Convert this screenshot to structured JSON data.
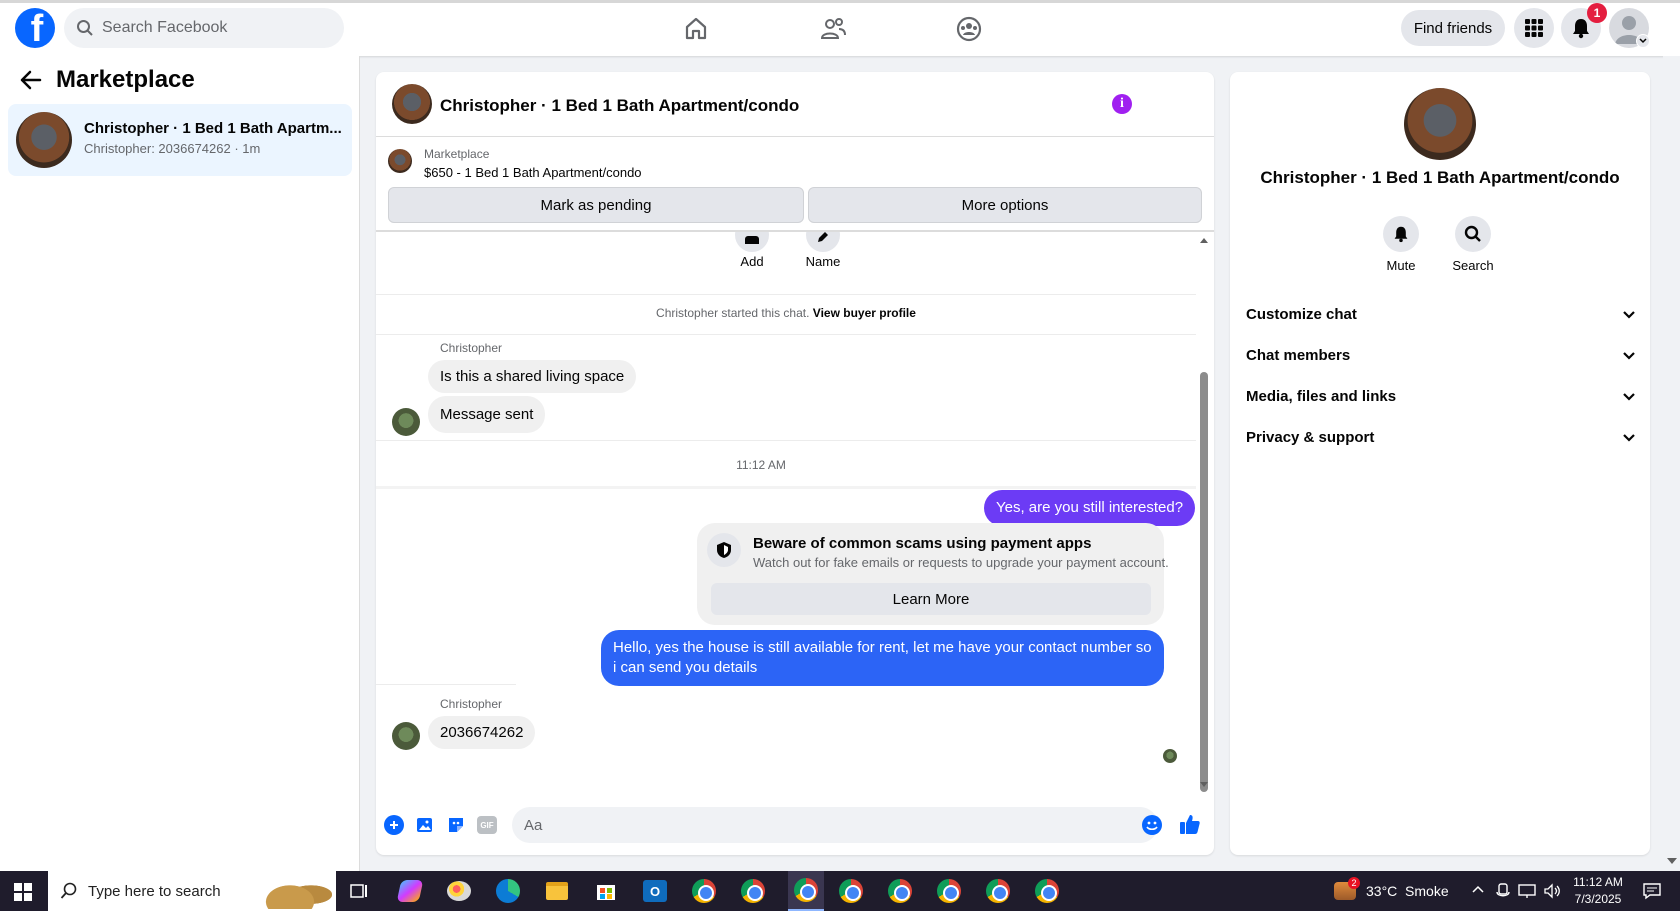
{
  "topbar": {
    "search_placeholder": "Search Facebook",
    "find_friends": "Find friends",
    "notification_count": "1"
  },
  "left": {
    "title": "Marketplace",
    "conversation": {
      "title": "Christopher · 1 Bed 1 Bath Apartm...",
      "subtitle": "Christopher: 2036674262 · 1m"
    }
  },
  "chat": {
    "header_title": "Christopher · 1 Bed 1 Bath Apartment/condo",
    "listing_label": "Marketplace",
    "listing_title": "$650 - 1 Bed 1 Bath Apartment/condo",
    "mark_pending": "Mark as pending",
    "more_options": "More options",
    "add_label": "Add",
    "name_label": "Name",
    "started_text": "Christopher started this chat.",
    "view_buyer": "View buyer profile",
    "sender_name_1": "Christopher",
    "msg_1": "Is this a shared living space",
    "msg_2": "Message sent",
    "timestamp": "11:12 AM",
    "msg_3": "Yes, are you still interested?",
    "scam_title": "Beware of common scams using payment apps",
    "scam_text": "Watch out for fake emails or requests to upgrade your payment account.",
    "learn_more": "Learn More",
    "msg_4": "Hello, yes the house is still available for rent, let me have your contact number so i can send you details",
    "sender_name_2": "Christopher",
    "msg_5": "2036674262",
    "composer_placeholder": "Aa"
  },
  "right": {
    "title": "Christopher · 1 Bed 1 Bath Apartment/condo",
    "mute": "Mute",
    "search": "Search",
    "sections": [
      "Customize chat",
      "Chat members",
      "Media, files and links",
      "Privacy & support"
    ]
  },
  "taskbar": {
    "search_placeholder": "Type here to search",
    "weather_badge": "2",
    "weather": "33°C  Smoke",
    "time": "11:12 AM",
    "date": "7/3/2025"
  },
  "colors": {
    "accent": "#0866ff",
    "outgoing": "#2c64f6",
    "purple_info": "#a020f0",
    "notification": "#e41e3f"
  }
}
